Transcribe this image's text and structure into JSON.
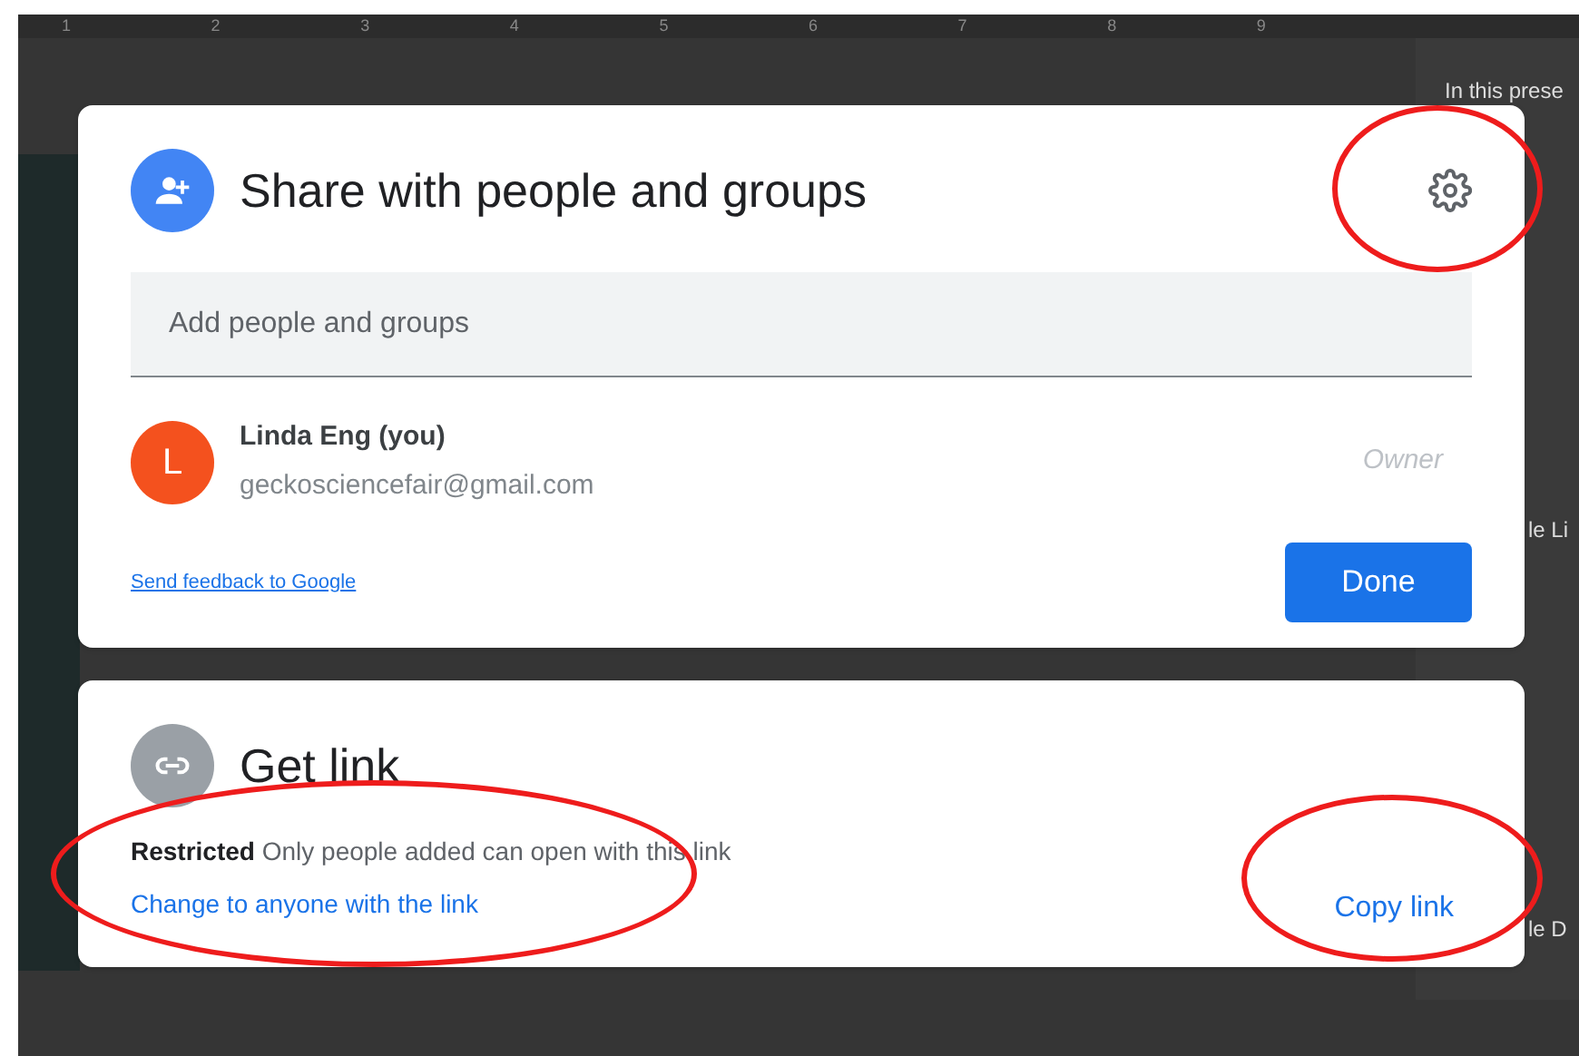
{
  "ruler": {
    "ticks": [
      "1",
      "2",
      "3",
      "4",
      "5",
      "6",
      "7",
      "8",
      "9"
    ]
  },
  "side_panel": {
    "texts": [
      "In this prese",
      "le Li",
      "le D"
    ]
  },
  "share_card": {
    "title": "Share with people and groups",
    "search": {
      "placeholder": "Add people and groups"
    },
    "people": [
      {
        "initial": "L",
        "name": "Linda Eng (you)",
        "email": "geckosciencefair@gmail.com",
        "role": "Owner",
        "color": "#f4511e"
      }
    ],
    "feedback_link": "Send feedback to Google",
    "done_button": "Done"
  },
  "link_card": {
    "title": "Get link",
    "access_label": "Restricted",
    "access_description": "Only people added can open with this link",
    "change_link": "Change to anyone with the link",
    "copy_button": "Copy link"
  },
  "annotations": [
    {
      "kind": "ellipse"
    },
    {
      "kind": "ellipse"
    },
    {
      "kind": "ellipse"
    }
  ]
}
